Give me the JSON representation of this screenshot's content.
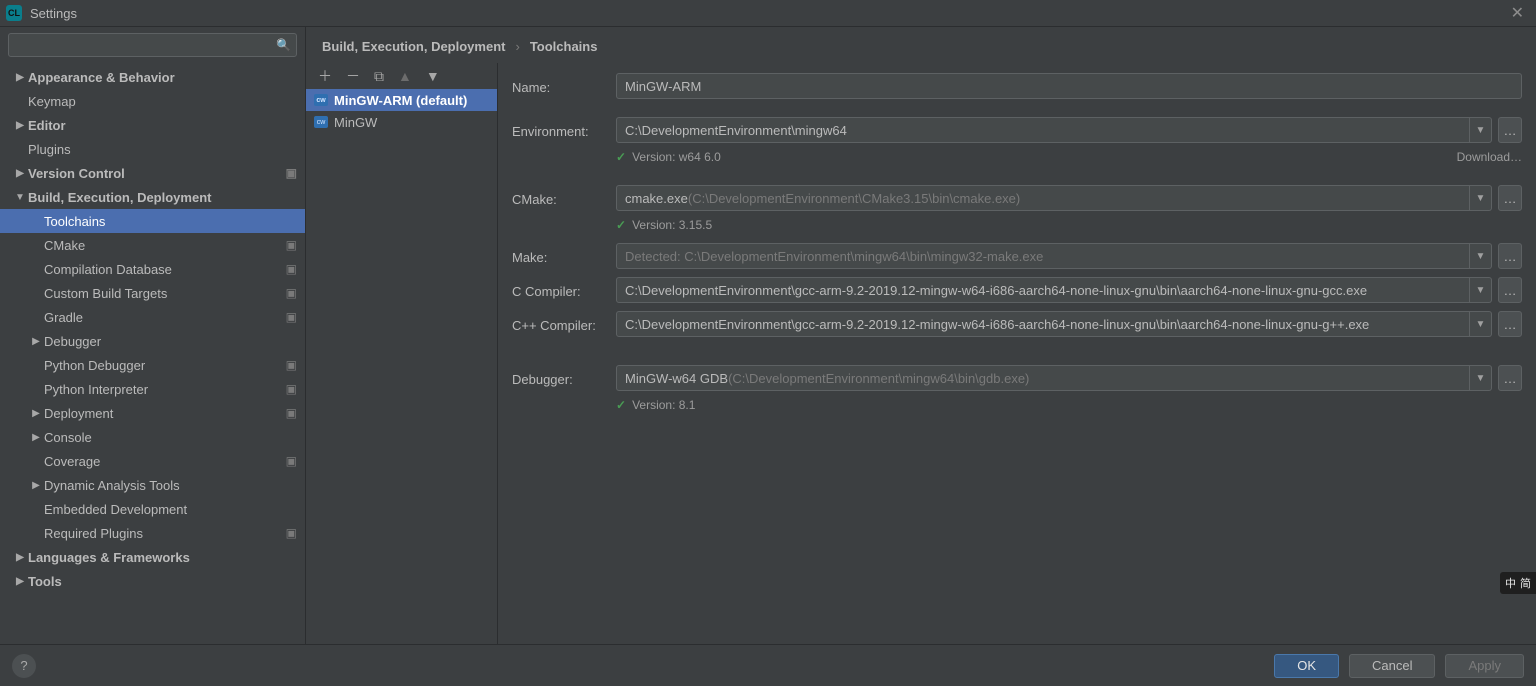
{
  "titlebar": {
    "title": "Settings"
  },
  "search": {
    "placeholder": ""
  },
  "sidebar": {
    "appearance": "Appearance & Behavior",
    "keymap": "Keymap",
    "editor": "Editor",
    "plugins": "Plugins",
    "version_control": "Version Control",
    "build": "Build, Execution, Deployment",
    "toolchains": "Toolchains",
    "cmake": "CMake",
    "compilation_db": "Compilation Database",
    "custom_build": "Custom Build Targets",
    "gradle": "Gradle",
    "debugger": "Debugger",
    "python_debugger": "Python Debugger",
    "python_interpreter": "Python Interpreter",
    "deployment": "Deployment",
    "console": "Console",
    "coverage": "Coverage",
    "dyn_analysis": "Dynamic Analysis Tools",
    "embedded": "Embedded Development",
    "required_plugins": "Required Plugins",
    "lang_fw": "Languages & Frameworks",
    "tools": "Tools"
  },
  "breadcrumb": {
    "a": "Build, Execution, Deployment",
    "b": "Toolchains"
  },
  "tc_list": {
    "item0": "MinGW-ARM (default)",
    "item1": "MinGW"
  },
  "form": {
    "labels": {
      "name": "Name:",
      "environment": "Environment:",
      "cmake": "CMake:",
      "make": "Make:",
      "ccompiler": "C Compiler:",
      "cppcompiler": "C++ Compiler:",
      "debugger": "Debugger:"
    },
    "name_value": "MinGW-ARM",
    "environment_value": "C:\\DevelopmentEnvironment\\mingw64",
    "env_version": "Version: w64 6.0",
    "download": "Download…",
    "cmake_prefix": "cmake.exe ",
    "cmake_suffix": "(C:\\DevelopmentEnvironment\\CMake3.15\\bin\\cmake.exe)",
    "cmake_version": "Version: 3.15.5",
    "make_prefix": "Detected: ",
    "make_suffix": "C:\\DevelopmentEnvironment\\mingw64\\bin\\mingw32-make.exe",
    "ccompiler_value": "C:\\DevelopmentEnvironment\\gcc-arm-9.2-2019.12-mingw-w64-i686-aarch64-none-linux-gnu\\bin\\aarch64-none-linux-gnu-gcc.exe",
    "cppcompiler_value": "C:\\DevelopmentEnvironment\\gcc-arm-9.2-2019.12-mingw-w64-i686-aarch64-none-linux-gnu\\bin\\aarch64-none-linux-gnu-g++.exe",
    "debugger_prefix": "MinGW-w64 GDB ",
    "debugger_suffix": "(C:\\DevelopmentEnvironment\\mingw64\\bin\\gdb.exe)",
    "debugger_version": "Version: 8.1"
  },
  "footer": {
    "ok": "OK",
    "cancel": "Cancel",
    "apply": "Apply"
  },
  "ime": {
    "a": "中",
    "b": "简"
  }
}
